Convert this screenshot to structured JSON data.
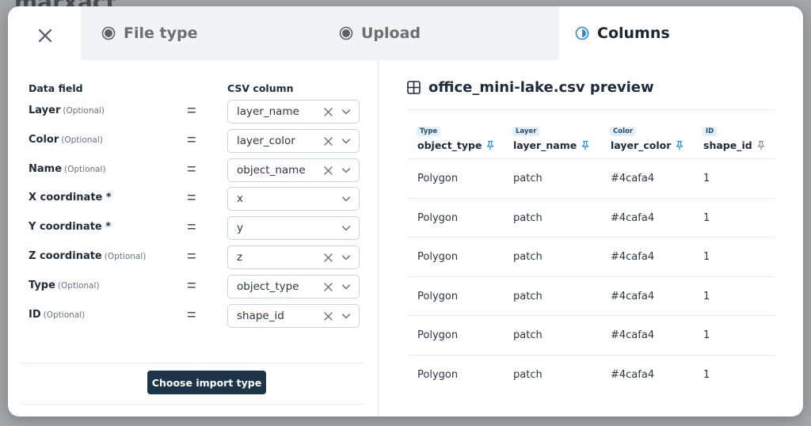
{
  "background": {
    "logo_text": "marxact"
  },
  "tabs": [
    {
      "label": "File type",
      "state": "done"
    },
    {
      "label": "Upload",
      "state": "done"
    },
    {
      "label": "Columns",
      "state": "active"
    }
  ],
  "mapping": {
    "header_field": "Data field",
    "header_column": "CSV column",
    "rows": [
      {
        "label": "Layer",
        "optional": "(Optional)",
        "value": "layer_name",
        "clearable": true
      },
      {
        "label": "Color",
        "optional": "(Optional)",
        "value": "layer_color",
        "clearable": true
      },
      {
        "label": "Name",
        "optional": "(Optional)",
        "value": "object_name",
        "clearable": true
      },
      {
        "label": "X coordinate *",
        "optional": "",
        "value": "x",
        "clearable": false
      },
      {
        "label": "Y coordinate *",
        "optional": "",
        "value": "y",
        "clearable": false
      },
      {
        "label": "Z coordinate",
        "optional": "(Optional)",
        "value": "z",
        "clearable": true
      },
      {
        "label": "Type",
        "optional": "(Optional)",
        "value": "object_type",
        "clearable": true
      },
      {
        "label": "ID",
        "optional": "(Optional)",
        "value": "shape_id",
        "clearable": true
      }
    ],
    "equals_symbol": "=",
    "choose_button": "Choose import type"
  },
  "preview": {
    "title": "office_mini-lake.csv preview",
    "columns": [
      {
        "badge": "Type",
        "name": "object_type"
      },
      {
        "badge": "Layer",
        "name": "layer_name"
      },
      {
        "badge": "Color",
        "name": "layer_color"
      },
      {
        "badge": "ID",
        "name": "shape_id"
      }
    ],
    "rows": [
      [
        "Polygon",
        "patch",
        "#4cafa4",
        "1"
      ],
      [
        "Polygon",
        "patch",
        "#4cafa4",
        "1"
      ],
      [
        "Polygon",
        "patch",
        "#4cafa4",
        "1"
      ],
      [
        "Polygon",
        "patch",
        "#4cafa4",
        "1"
      ],
      [
        "Polygon",
        "patch",
        "#4cafa4",
        "1"
      ],
      [
        "Polygon",
        "patch",
        "#4cafa4",
        "1"
      ]
    ]
  },
  "colors": {
    "accent": "#2a8bd6",
    "button_bg": "#1d3548",
    "badge_bg": "#dff0fb"
  }
}
